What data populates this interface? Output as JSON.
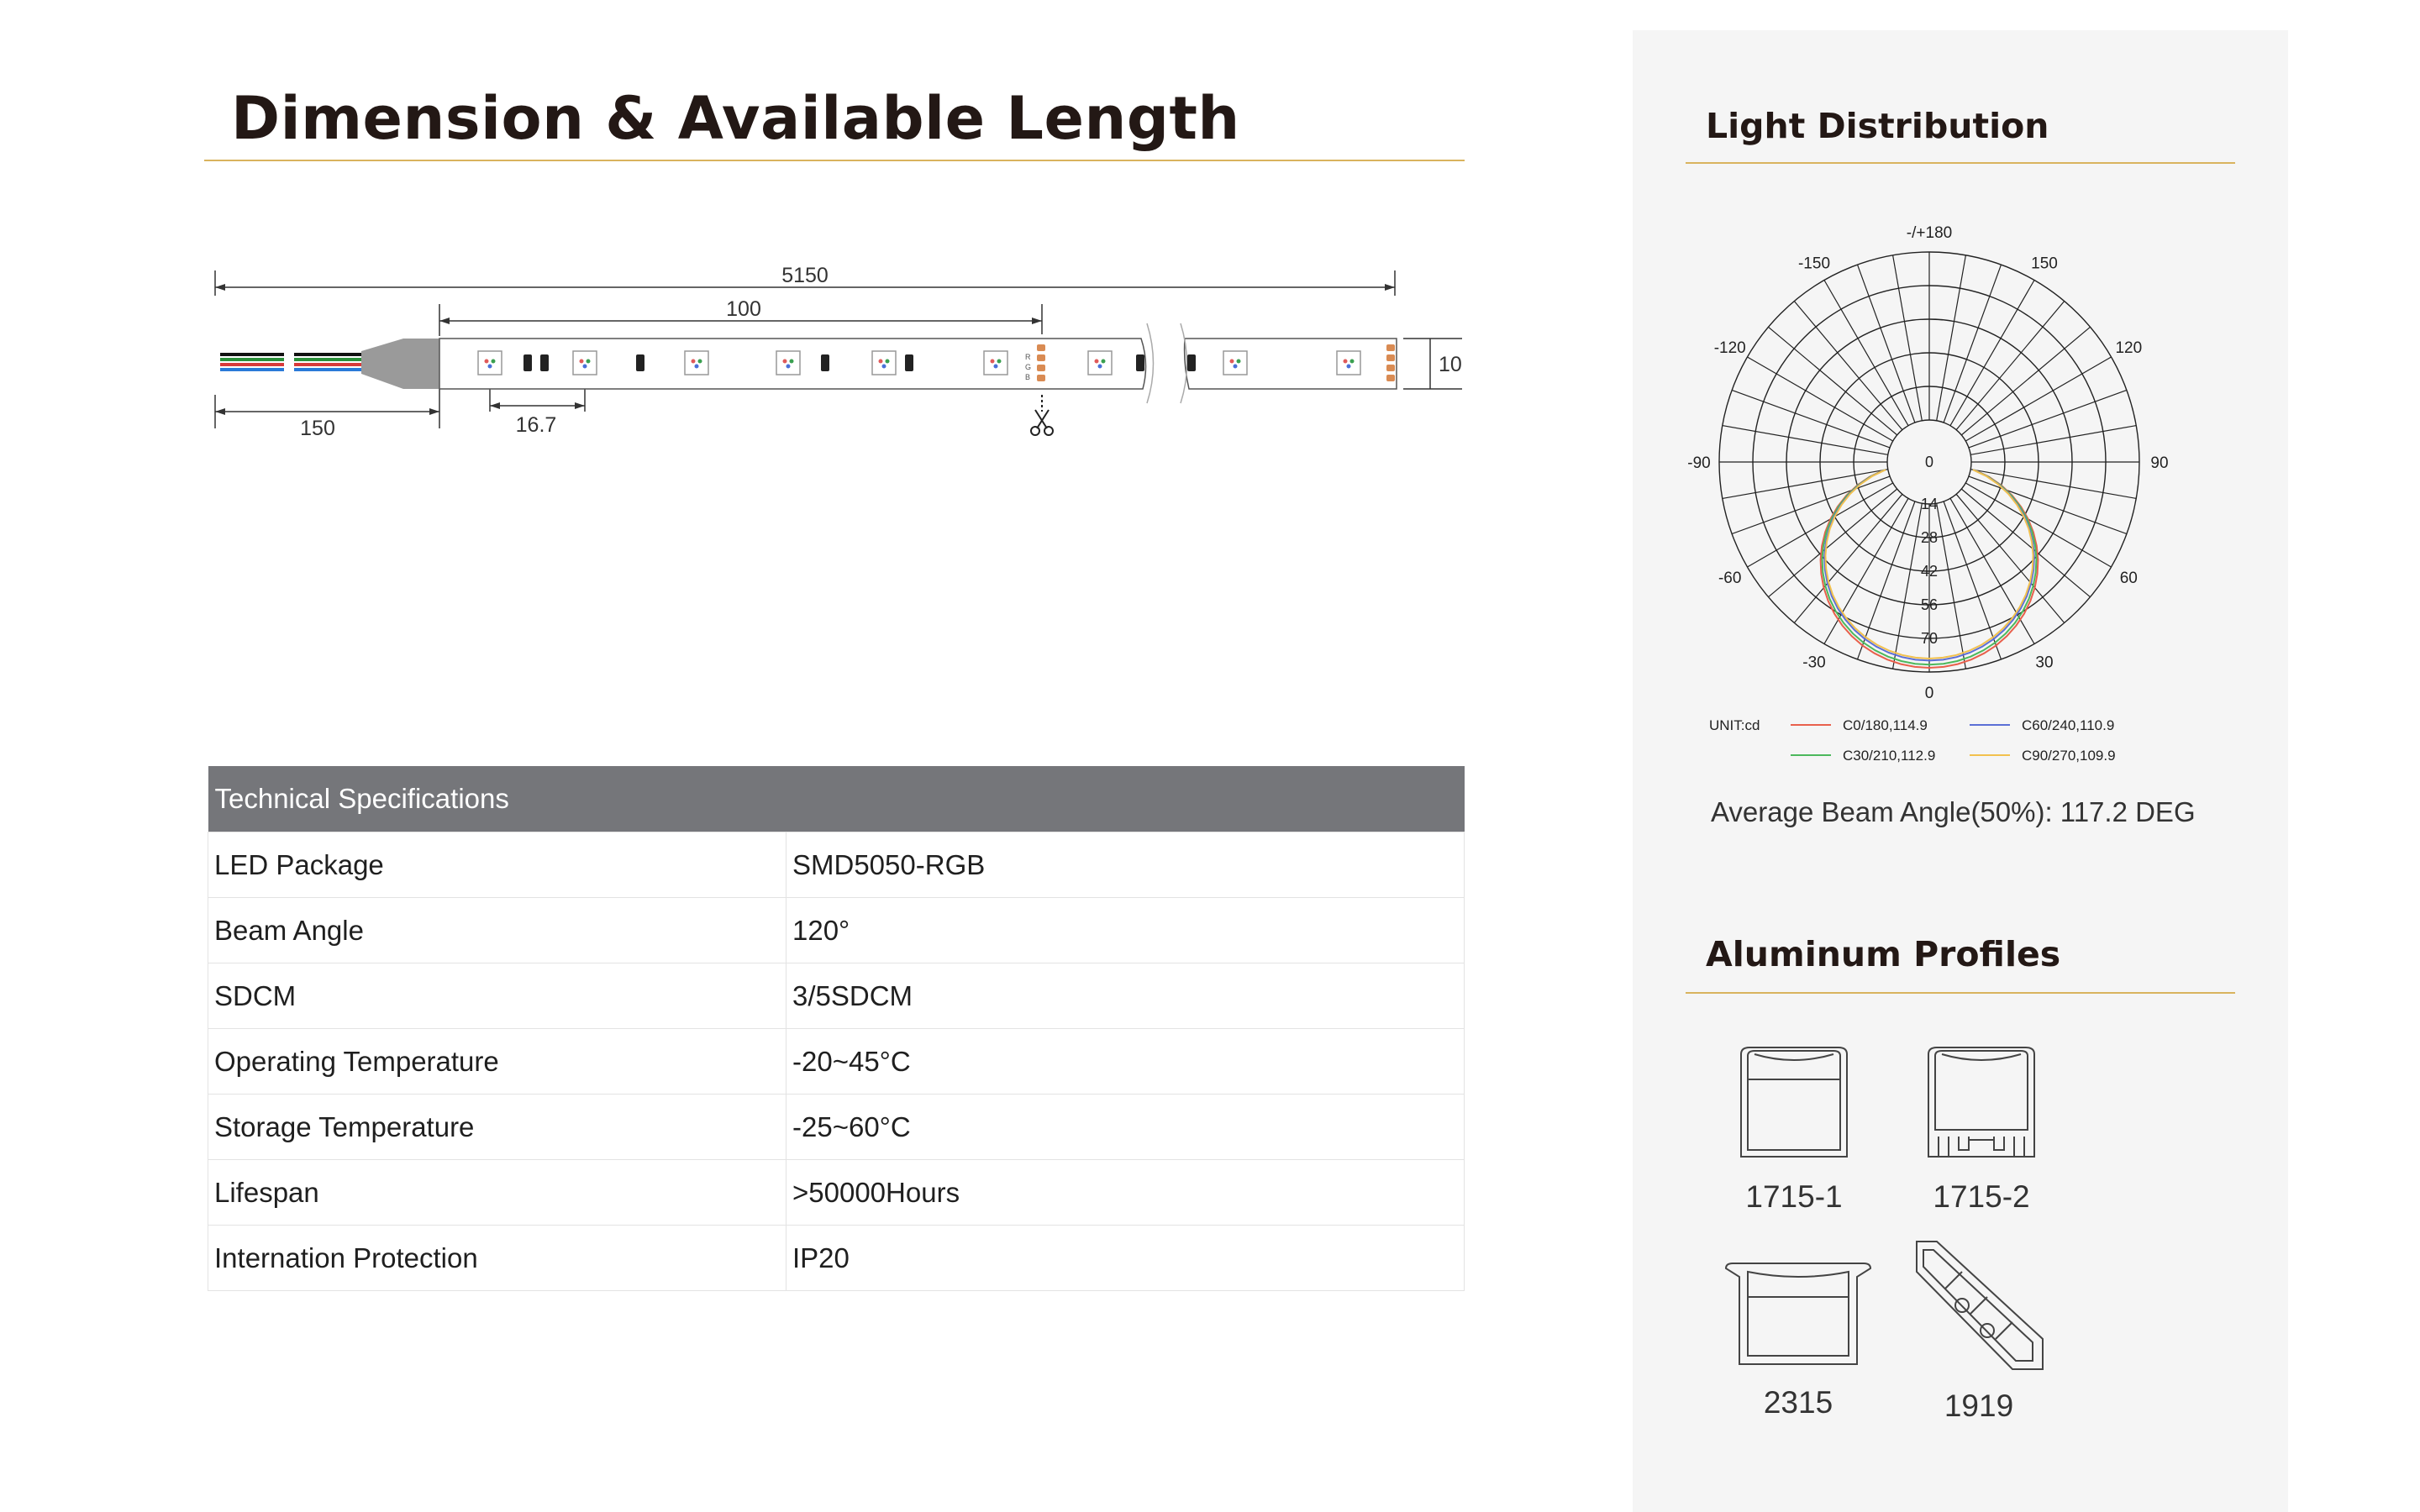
{
  "left": {
    "title": "Dimension & Available Length",
    "dimensions": {
      "total_length": "5150",
      "cut_length": "100",
      "lead_length": "150",
      "pitch": "16.7",
      "width": "10"
    },
    "pad_labels": [
      "R",
      "G",
      "B"
    ],
    "cut_icon": "scissors-icon"
  },
  "specs": {
    "header": "Technical Specifications",
    "rows": [
      {
        "label": "LED Package",
        "value": "SMD5050-RGB"
      },
      {
        "label": "Beam Angle",
        "value": "120°"
      },
      {
        "label": "SDCM",
        "value": "3/5SDCM"
      },
      {
        "label": "Operating Temperature",
        "value": "-20~45°C"
      },
      {
        "label": "Storage Temperature",
        "value": "-25~60°C"
      },
      {
        "label": "Lifespan",
        "value": ">50000Hours"
      },
      {
        "label": "Internation Protection",
        "value": "IP20"
      }
    ]
  },
  "right": {
    "light_title": "Light Distribution",
    "polar": {
      "angle_labels": [
        "-/+180",
        "150",
        "120",
        "90",
        "60",
        "30",
        "0",
        "-30",
        "-60",
        "-90",
        "-120",
        "-150"
      ],
      "radial_labels": [
        "0",
        "14",
        "28",
        "42",
        "56",
        "70"
      ],
      "unit": "UNIT:cd",
      "legend": [
        {
          "label": "C0/180,114.9",
          "color": "#e8604c"
        },
        {
          "label": "C60/240,110.9",
          "color": "#5b6fd6"
        },
        {
          "label": "C30/210,112.9",
          "color": "#4cb85c"
        },
        {
          "label": "C90/270,109.9",
          "color": "#f2c14e"
        }
      ]
    },
    "beam_angle": "Average Beam Angle(50%): 117.2 DEG",
    "profiles_title": "Aluminum Profiles",
    "profiles": [
      {
        "label": "1715-1",
        "icon": "profile-1715-1-icon"
      },
      {
        "label": "1715-2",
        "icon": "profile-1715-2-icon"
      },
      {
        "label": "2315",
        "icon": "profile-2315-icon"
      },
      {
        "label": "1919",
        "icon": "profile-1919-icon"
      }
    ]
  }
}
